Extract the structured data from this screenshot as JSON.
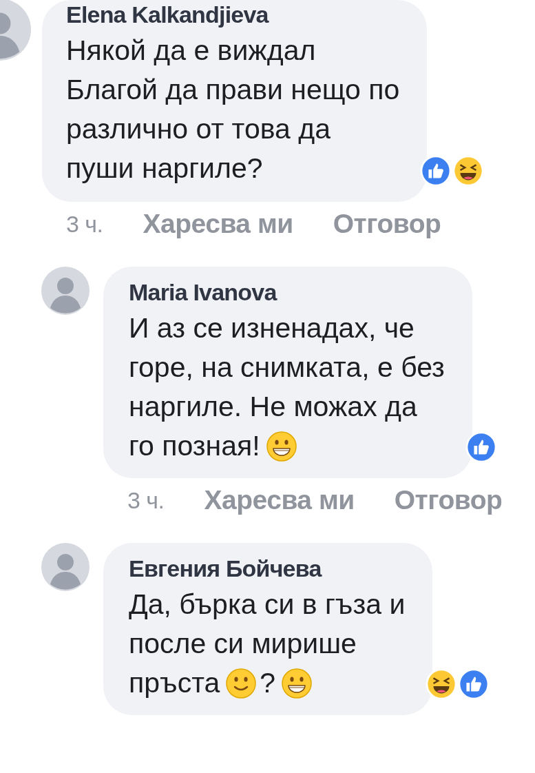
{
  "comments": [
    {
      "author": "Elena Kalkandjieva",
      "reply": false,
      "lines": [
        [
          {
            "kind": "text",
            "text": "Някой да е виждал"
          }
        ],
        [
          {
            "kind": "text",
            "text": "Благой да прави нещо по"
          }
        ],
        [
          {
            "kind": "text",
            "text": "различно от това да"
          }
        ],
        [
          {
            "kind": "text",
            "text": "пуши наргиле?"
          }
        ]
      ],
      "reactions": [
        {
          "kind": "like"
        },
        {
          "kind": "haha"
        }
      ],
      "time": "3 ч.",
      "actions": [
        "Харесва ми",
        "Отговор"
      ]
    },
    {
      "author": "Maria Ivanova",
      "reply": true,
      "lines": [
        [
          {
            "kind": "text",
            "text": "И аз се изненадах, че"
          }
        ],
        [
          {
            "kind": "text",
            "text": "горе, на снимката, е без"
          }
        ],
        [
          {
            "kind": "text",
            "text": "наргиле. Не можах да"
          }
        ],
        [
          {
            "kind": "text",
            "text": "го позная!"
          },
          {
            "kind": "grin"
          }
        ]
      ],
      "reactions": [
        {
          "kind": "like"
        }
      ],
      "time": "3 ч.",
      "actions": [
        "Харесва ми",
        "Отговор"
      ]
    },
    {
      "author": "Евгения Бойчева",
      "reply": true,
      "lines": [
        [
          {
            "kind": "text",
            "text": "Да, бърка си в гъза и"
          }
        ],
        [
          {
            "kind": "text",
            "text": "после си мирише"
          }
        ],
        [
          {
            "kind": "text",
            "text": "пръста"
          },
          {
            "kind": "smile"
          },
          {
            "kind": "text",
            "text": "?"
          },
          {
            "kind": "grin"
          }
        ]
      ],
      "reactions": [
        {
          "kind": "haha"
        },
        {
          "kind": "like"
        }
      ]
    }
  ]
}
